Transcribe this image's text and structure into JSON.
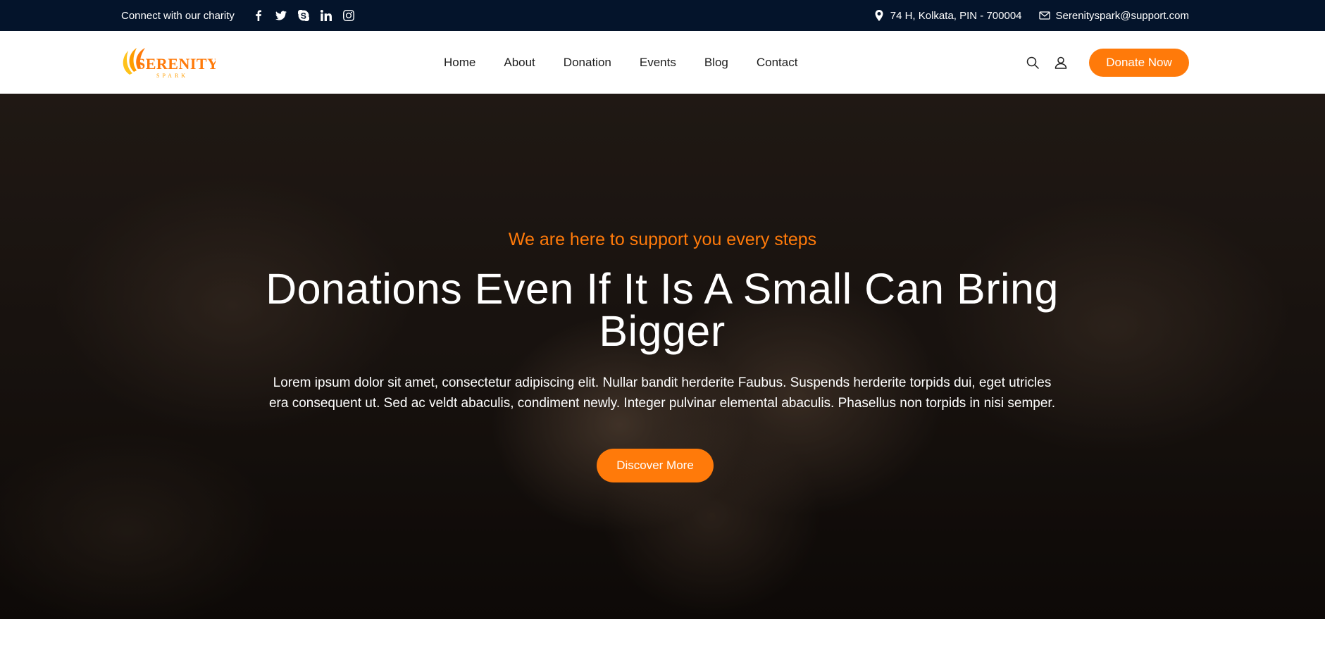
{
  "topbar": {
    "tagline": "Connect with our charity",
    "social": [
      "facebook-icon",
      "twitter-icon",
      "skype-icon",
      "linkedin-icon",
      "instagram-icon"
    ],
    "address": "74 H, Kolkata, PIN - 700004",
    "email": "Serenityspark@support.com"
  },
  "header": {
    "logo_text": "SERENITY",
    "logo_subtext": "SPARK",
    "nav": [
      "Home",
      "About",
      "Donation",
      "Events",
      "Blog",
      "Contact"
    ],
    "donate_label": "Donate Now"
  },
  "hero": {
    "subtitle": "We are here to support you every steps",
    "title": "Donations Even If It Is A Small Can Bring Bigger",
    "text": "Lorem ipsum dolor sit amet, consectetur adipiscing elit. Nullar bandit herderite Faubus. Suspends herderite torpids dui, eget utricles era consequent ut. Sed ac veldt abaculis, condiment newly. Integer pulvinar elemental abaculis. Phasellus non torpids in nisi semper.",
    "cta_label": "Discover More"
  },
  "colors": {
    "accent": "#ff7a0a",
    "topbar_bg": "#04142b"
  }
}
